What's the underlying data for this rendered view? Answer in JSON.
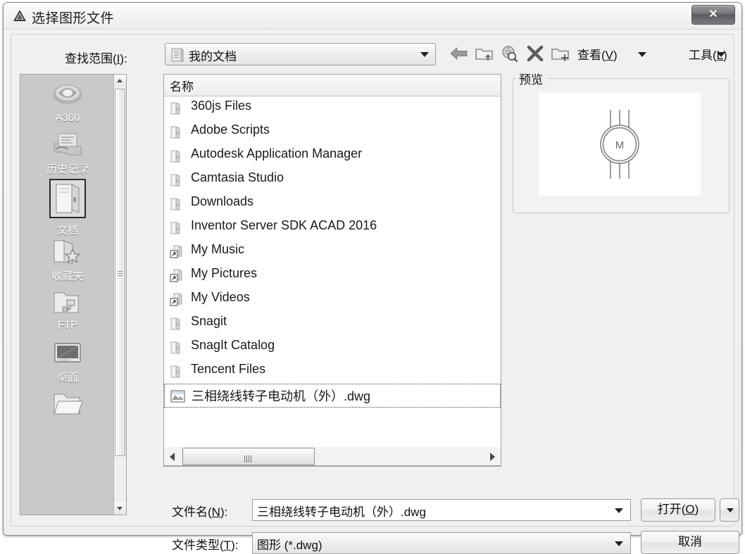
{
  "window": {
    "title": "选择图形文件",
    "logo_icon": "autocad-triangle-icon",
    "close_label": "✕"
  },
  "toolbar": {
    "lookin_label_pre": "查找范围(",
    "lookin_label_key": "I",
    "lookin_label_post": "):",
    "current_location": "我的文档",
    "location_icon": "folder-icon",
    "buttons": [
      {
        "name": "back-button",
        "icon": "back-arrow-icon"
      },
      {
        "name": "up-one-level-button",
        "icon": "folder-up-icon"
      },
      {
        "name": "search-web-button",
        "icon": "globe-search-icon"
      },
      {
        "name": "delete-button",
        "icon": "delete-x-icon"
      },
      {
        "name": "new-folder-button",
        "icon": "folder-new-icon"
      }
    ],
    "view_menu_pre": "查看(",
    "view_menu_key": "V",
    "view_menu_post": ")",
    "tools_menu_pre": "工具(",
    "tools_menu_key": "L",
    "tools_menu_post": ")"
  },
  "places": [
    {
      "label": "A360",
      "icon": "a360-cloud-icon",
      "selected": false
    },
    {
      "label": "历史记录",
      "icon": "history-icon",
      "selected": false
    },
    {
      "label": "文档",
      "icon": "documents-icon",
      "selected": true
    },
    {
      "label": "收藏夹",
      "icon": "favorites-star-icon",
      "selected": false
    },
    {
      "label": "FTP",
      "icon": "ftp-folder-icon",
      "selected": false
    },
    {
      "label": "桌面",
      "icon": "desktop-monitor-icon",
      "selected": false
    },
    {
      "label": "",
      "icon": "folder-icon",
      "selected": false
    }
  ],
  "filelist": {
    "column_header": "名称",
    "sort_indicator": "ascending",
    "rows": [
      {
        "name": "360js Files",
        "icon": "folder-icon",
        "selected": false
      },
      {
        "name": "Adobe Scripts",
        "icon": "folder-icon",
        "selected": false
      },
      {
        "name": "Autodesk Application Manager",
        "icon": "folder-icon",
        "selected": false
      },
      {
        "name": "Camtasia Studio",
        "icon": "folder-icon",
        "selected": false
      },
      {
        "name": "Downloads",
        "icon": "folder-icon",
        "selected": false
      },
      {
        "name": "Inventor Server SDK ACAD 2016",
        "icon": "folder-icon",
        "selected": false
      },
      {
        "name": "My Music",
        "icon": "folder-shortcut-icon",
        "selected": false
      },
      {
        "name": "My Pictures",
        "icon": "folder-shortcut-icon",
        "selected": false
      },
      {
        "name": "My Videos",
        "icon": "folder-shortcut-icon",
        "selected": false
      },
      {
        "name": "Snagit",
        "icon": "folder-icon",
        "selected": false
      },
      {
        "name": "SnagIt Catalog",
        "icon": "folder-icon",
        "selected": false
      },
      {
        "name": "Tencent Files",
        "icon": "folder-icon",
        "selected": false
      },
      {
        "name": "三相绕线转子电动机（外）.dwg",
        "icon": "dwg-file-icon",
        "selected": true
      }
    ]
  },
  "preview": {
    "legend": "预览",
    "drawing": "three-phase-wound-rotor-motor-symbol"
  },
  "fields": {
    "filename_label_pre": "文件名(",
    "filename_label_key": "N",
    "filename_label_post": "):",
    "filename_value": "三相绕线转子电动机（外）.dwg",
    "filetype_label_pre": "文件类型(",
    "filetype_label_key": "T",
    "filetype_label_post": "):",
    "filetype_value": "图形 (*.dwg)"
  },
  "actions": {
    "open_pre": "打开(",
    "open_key": "O",
    "open_post": ")",
    "cancel": "取消"
  },
  "colors": {
    "dialog_bg": "#f0f0ee",
    "places_bg": "#c9c9c7",
    "list_bg": "#ffffff",
    "border": "#a4a4a2",
    "text": "#111111"
  }
}
